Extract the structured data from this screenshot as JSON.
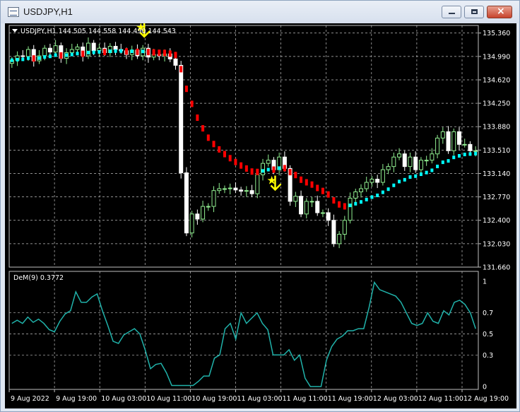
{
  "window": {
    "title": "USDJPY,H1",
    "buttons": {
      "minimize": "minimize-icon",
      "maximize": "maximize-icon",
      "close": "close-icon"
    }
  },
  "colors": {
    "background": "#000000",
    "grid": "#c0c0c0",
    "candle_up": "#90ee90",
    "candle_down": "#ffffff",
    "trend_up": "#00ffff",
    "trend_down": "#ff0000",
    "arrow": "#ffff00",
    "demarker": "#20b2aa",
    "text": "#ffffff"
  },
  "chart_data": [
    {
      "type": "candlestick",
      "title": "USDJPY,H1",
      "header_text": "USDJPY,H1  144.505 144.558 144.490 144.543",
      "ohlc_readout": {
        "open": 144.505,
        "high": 144.558,
        "low": 144.49,
        "close": 144.543
      },
      "ylim": [
        131.66,
        135.48
      ],
      "y_ticks": [
        "135.360",
        "134.990",
        "134.620",
        "134.250",
        "133.880",
        "133.510",
        "133.140",
        "132.770",
        "132.400",
        "132.030",
        "131.660"
      ],
      "x_labels": [
        "9 Aug 2022",
        "9 Aug 19:00",
        "10 Aug 03:00",
        "10 Aug 11:00",
        "10 Aug 19:00",
        "11 Aug 03:00",
        "11 Aug 11:00",
        "11 Aug 19:00",
        "12 Aug 03:00",
        "12 Aug 11:00",
        "12 Aug 19:00"
      ],
      "grid": true,
      "close_prices": [
        134.93,
        135.0,
        134.99,
        135.1,
        134.92,
        135.0,
        135.12,
        135.06,
        135.16,
        134.96,
        135.05,
        135.1,
        135.14,
        135.0,
        135.2,
        135.08,
        135.12,
        135.05,
        135.15,
        135.1,
        135.08,
        135.02,
        135.09,
        135.0,
        135.12,
        134.98,
        135.02,
        135.0,
        135.03,
        134.95,
        134.85,
        133.15,
        132.2,
        132.5,
        132.42,
        132.62,
        132.62,
        132.87,
        132.9,
        132.9,
        132.91,
        132.88,
        132.86,
        132.87,
        132.82,
        133.12,
        133.3,
        133.35,
        133.2,
        133.4,
        133.22,
        132.7,
        132.78,
        132.5,
        132.7,
        132.7,
        132.52,
        132.52,
        132.4,
        132.03,
        132.18,
        132.4,
        132.75,
        132.85,
        132.9,
        133.0,
        133.05,
        133.0,
        133.2,
        133.25,
        133.4,
        133.45,
        133.25,
        133.4,
        133.2,
        133.35,
        133.35,
        133.45,
        133.7,
        133.8,
        133.5,
        133.8,
        133.6,
        133.6,
        133.5,
        133.5
      ],
      "arrows": [
        {
          "bar": 24,
          "direction": "down",
          "price": 135.37
        },
        {
          "bar": 48,
          "direction": "down",
          "price": 132.95
        }
      ],
      "series": [
        {
          "name": "trend",
          "up_color": "#00ffff",
          "down_color": "#ff0000"
        }
      ]
    },
    {
      "type": "line",
      "title": "DeM(9) 0.3772",
      "ylim": [
        0,
        1
      ],
      "y_ticks": [
        "1",
        "0.7",
        "0.5",
        "0.3",
        "0"
      ],
      "values": [
        0.6,
        0.63,
        0.6,
        0.66,
        0.61,
        0.64,
        0.6,
        0.54,
        0.52,
        0.62,
        0.69,
        0.72,
        0.9,
        0.8,
        0.8,
        0.85,
        0.88,
        0.72,
        0.58,
        0.43,
        0.41,
        0.49,
        0.52,
        0.55,
        0.5,
        0.35,
        0.17,
        0.21,
        0.22,
        0.13,
        0.01,
        0.01,
        0.01,
        0.01,
        0.01,
        0.05,
        0.1,
        0.1,
        0.27,
        0.3,
        0.55,
        0.6,
        0.45,
        0.7,
        0.6,
        0.65,
        0.7,
        0.6,
        0.54,
        0.3,
        0.3,
        0.3,
        0.35,
        0.25,
        0.3,
        0.08,
        0.0,
        0.0,
        0.0,
        0.25,
        0.38,
        0.45,
        0.48,
        0.53,
        0.53,
        0.55,
        0.55,
        0.75,
        0.99,
        0.92,
        0.9,
        0.88,
        0.86,
        0.8,
        0.7,
        0.6,
        0.58,
        0.6,
        0.7,
        0.62,
        0.6,
        0.72,
        0.68,
        0.8,
        0.82,
        0.78,
        0.7,
        0.55
      ]
    }
  ]
}
